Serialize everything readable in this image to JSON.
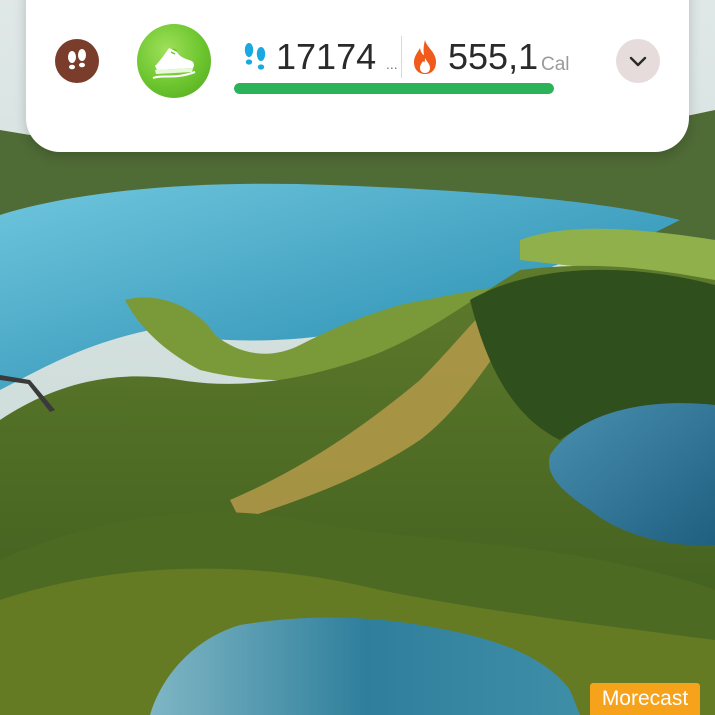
{
  "widget": {
    "steps": "17174",
    "steps_more": "...",
    "calories": "555,1",
    "calories_unit": "Cal",
    "progress": 1.0
  },
  "icons": {
    "steps_button": "footprints-icon",
    "app_logo": "running-shoe-icon",
    "steps_stat": "footprints-icon",
    "calories_stat": "flame-icon",
    "expand": "chevron-down-icon"
  },
  "colors": {
    "progress": "#2cb35a",
    "app_logo": "#6cc52e",
    "steps_button_bg": "#7a3d2c",
    "flame": "#f05a1a",
    "footprints": "#1aa8e0",
    "ad_badge": "#f6a21a"
  },
  "ad": {
    "label": "Morecast"
  }
}
